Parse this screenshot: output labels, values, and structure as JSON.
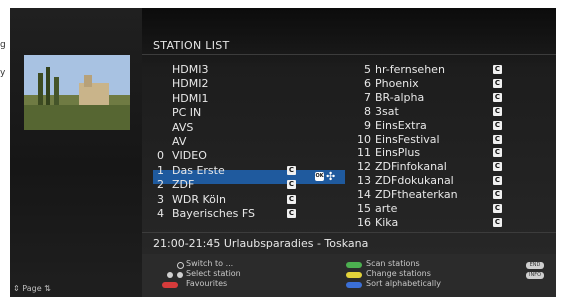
{
  "title": "STATION LIST",
  "left_column": [
    {
      "num": "",
      "name": "HDMI3",
      "badge": ""
    },
    {
      "num": "",
      "name": "HDMI2",
      "badge": ""
    },
    {
      "num": "",
      "name": "HDMI1",
      "badge": ""
    },
    {
      "num": "",
      "name": "PC IN",
      "badge": ""
    },
    {
      "num": "",
      "name": "AVS",
      "badge": ""
    },
    {
      "num": "",
      "name": "AV",
      "badge": ""
    },
    {
      "num": "0",
      "name": "VIDEO",
      "badge": ""
    },
    {
      "num": "1",
      "name": "Das Erste",
      "badge": "C"
    },
    {
      "num": "2",
      "name": "ZDF",
      "badge": "C"
    },
    {
      "num": "3",
      "name": "WDR Köln",
      "badge": "C"
    },
    {
      "num": "4",
      "name": "Bayerisches FS",
      "badge": "C"
    }
  ],
  "right_column": [
    {
      "num": "5",
      "name": "hr-fernsehen",
      "badge": "C"
    },
    {
      "num": "6",
      "name": "Phoenix",
      "badge": "C"
    },
    {
      "num": "7",
      "name": "BR-alpha",
      "badge": "C"
    },
    {
      "num": "8",
      "name": "3sat",
      "badge": "C"
    },
    {
      "num": "9",
      "name": "EinsExtra",
      "badge": "C"
    },
    {
      "num": "10",
      "name": "EinsFestival",
      "badge": "C"
    },
    {
      "num": "11",
      "name": "EinsPlus",
      "badge": "C"
    },
    {
      "num": "12",
      "name": "ZDFinfokanal",
      "badge": "C"
    },
    {
      "num": "13",
      "name": "ZDFdokukanal",
      "badge": "C"
    },
    {
      "num": "14",
      "name": "ZDFtheaterkan",
      "badge": "C"
    },
    {
      "num": "15",
      "name": "arte",
      "badge": "C"
    },
    {
      "num": "16",
      "name": "Kika",
      "badge": "C"
    }
  ],
  "selected": "Das Erste",
  "ok_label": "OK",
  "now_playing": "21:00-21:45 Urlaubsparadies - Toskana",
  "footer": {
    "switch_to": "Switch to ...",
    "select_station": "Select station",
    "favourites": "Favourites",
    "scan_stations": "Scan stations",
    "change_stations": "Change stations",
    "sort_alphabetically": "Sort alphabetically",
    "end_tag": "END",
    "info_tag": "INFO",
    "page": "Page"
  },
  "colors": {
    "red": "#d63b3b",
    "green": "#4caf50",
    "yellow": "#e3d23a",
    "blue": "#3b6fd6",
    "selection": "#1f5a9e"
  }
}
